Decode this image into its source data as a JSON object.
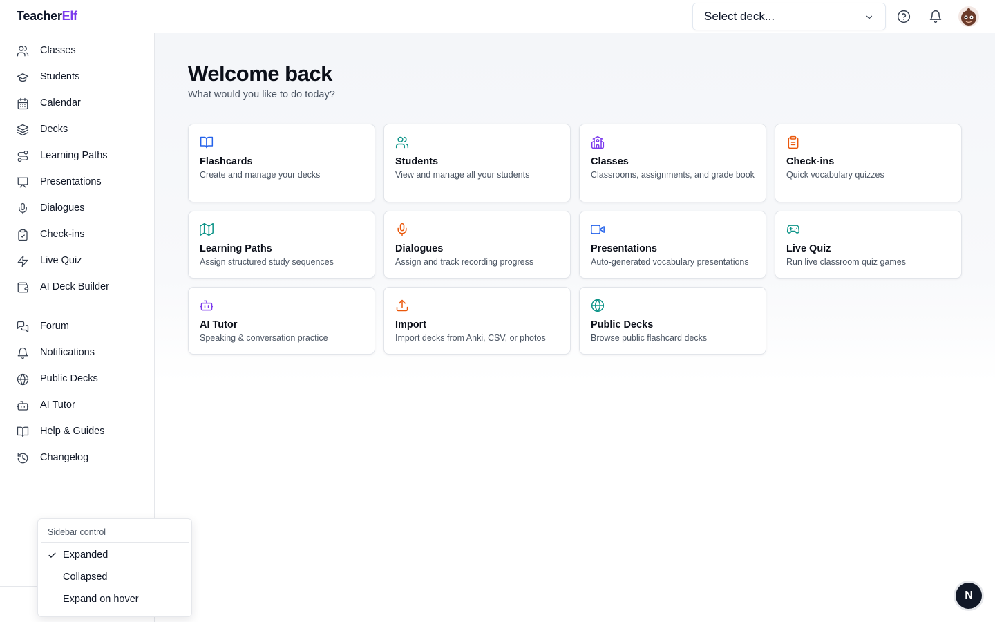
{
  "app": {
    "name_part1": "Teacher",
    "name_part2": "Elf",
    "accent_color": "#7c3aed"
  },
  "header": {
    "deck_select": {
      "value": "Select deck...",
      "icon": "chevron-down-icon"
    },
    "icons": [
      "help-circle-icon",
      "bell-icon"
    ],
    "avatar": "user-avatar"
  },
  "sidebar": {
    "primary": [
      {
        "label": "Classes",
        "icon": "users-icon"
      },
      {
        "label": "Students",
        "icon": "graduation-cap-icon"
      },
      {
        "label": "Calendar",
        "icon": "calendar-icon"
      },
      {
        "label": "Decks",
        "icon": "layers-icon"
      },
      {
        "label": "Learning Paths",
        "icon": "route-icon"
      },
      {
        "label": "Presentations",
        "icon": "presentation-icon"
      },
      {
        "label": "Dialogues",
        "icon": "mic-icon"
      },
      {
        "label": "Check-ins",
        "icon": "clipboard-check-icon"
      },
      {
        "label": "Live Quiz",
        "icon": "zap-icon"
      },
      {
        "label": "AI Deck Builder",
        "icon": "wallet-icon"
      }
    ],
    "secondary": [
      {
        "label": "Forum",
        "icon": "messages-icon"
      },
      {
        "label": "Notifications",
        "icon": "bell-icon"
      },
      {
        "label": "Public Decks",
        "icon": "globe-icon"
      },
      {
        "label": "AI Tutor",
        "icon": "bot-icon"
      },
      {
        "label": "Help & Guides",
        "icon": "book-open-icon"
      },
      {
        "label": "Changelog",
        "icon": "history-icon"
      }
    ],
    "toggle_icon": "panel-left-icon"
  },
  "main": {
    "title": "Welcome back",
    "subtitle": "What would you like to do today?",
    "cards": [
      {
        "title": "Flashcards",
        "desc": "Create and manage your decks",
        "icon": "book-open-icon",
        "color": "#2563eb"
      },
      {
        "title": "Students",
        "desc": "View and manage all your students",
        "icon": "users-icon",
        "color": "#0d9488"
      },
      {
        "title": "Classes",
        "desc": "Classrooms, assignments, and grade book",
        "icon": "school-icon",
        "color": "#7c3aed"
      },
      {
        "title": "Check-ins",
        "desc": "Quick vocabulary quizzes",
        "icon": "clipboard-icon",
        "color": "#ea580c"
      },
      {
        "title": "Learning Paths",
        "desc": "Assign structured study sequences",
        "icon": "map-icon",
        "color": "#0d9488"
      },
      {
        "title": "Dialogues",
        "desc": "Assign and track recording progress",
        "icon": "mic-icon",
        "color": "#ea580c"
      },
      {
        "title": "Presentations",
        "desc": "Auto-generated vocabulary presentations",
        "icon": "video-icon",
        "color": "#2563eb"
      },
      {
        "title": "Live Quiz",
        "desc": "Run live classroom quiz games",
        "icon": "gamepad-icon",
        "color": "#0d9488"
      },
      {
        "title": "AI Tutor",
        "desc": "Speaking & conversation practice",
        "icon": "bot-icon",
        "color": "#7c3aed"
      },
      {
        "title": "Import",
        "desc": "Import decks from Anki, CSV, or photos",
        "icon": "upload-icon",
        "color": "#ea580c"
      },
      {
        "title": "Public Decks",
        "desc": "Browse public flashcard decks",
        "icon": "globe-icon",
        "color": "#0d9488"
      }
    ]
  },
  "sidebar_menu": {
    "title": "Sidebar control",
    "options": [
      {
        "label": "Expanded",
        "checked": true
      },
      {
        "label": "Collapsed",
        "checked": false
      },
      {
        "label": "Expand on hover",
        "checked": false
      }
    ]
  },
  "fab": {
    "label": "N"
  }
}
